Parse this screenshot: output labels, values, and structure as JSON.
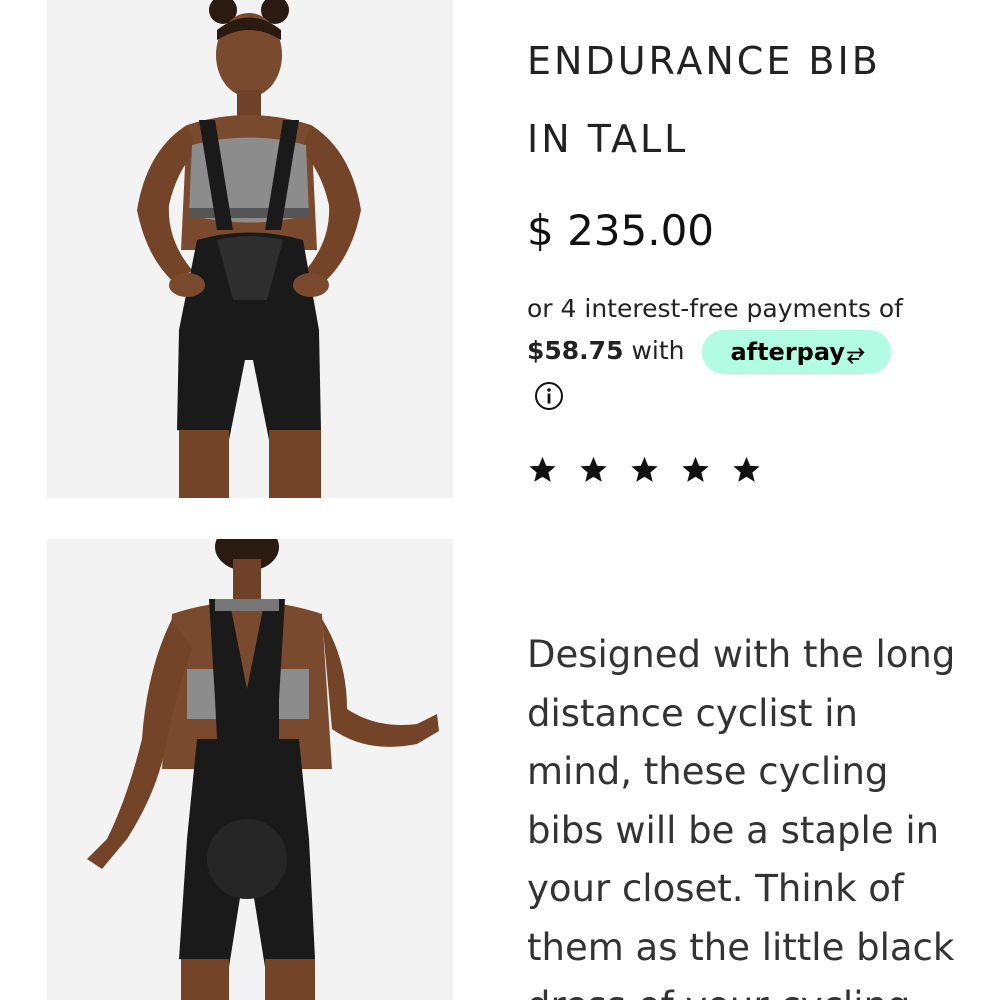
{
  "product": {
    "title_line1": "ENDURANCE BIB",
    "title_line2": "IN TALL",
    "price": "$ 235.00",
    "installments": {
      "prefix": "or 4 interest-free payments of",
      "amount": "$58.75",
      "with_text": "with",
      "provider_label": "afterpay",
      "provider_color": "#b2fce4",
      "info_icon": "info-icon"
    },
    "rating": {
      "stars": 5,
      "max": 5,
      "icon": "star-icon"
    },
    "description": "Designed with the long distance cyclist in mind, these cycling bibs will be a staple in your closet. Think of them as the little black dress of your cycling"
  },
  "images": {
    "front_icon": "product-photo-front",
    "back_icon": "product-photo-back",
    "background": "#f3f3f3",
    "garment_color": "#1a1a1a"
  }
}
